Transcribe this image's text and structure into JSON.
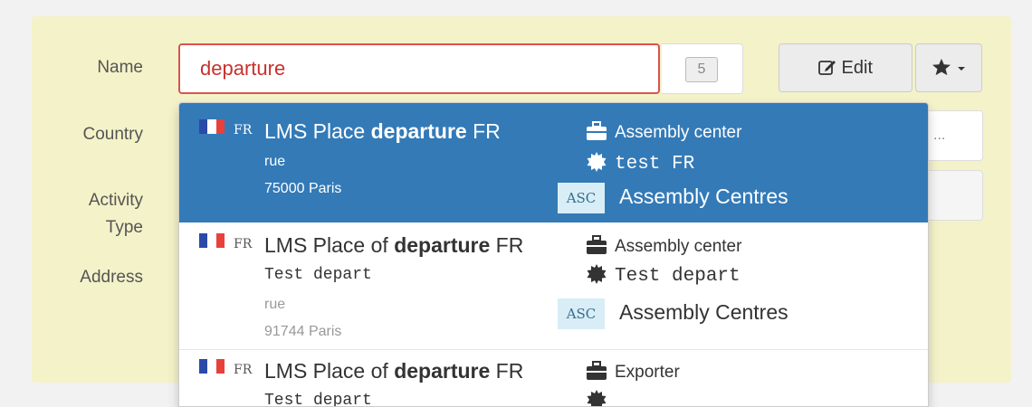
{
  "form": {
    "name_label": "Name",
    "country_label": "Country",
    "activity_label_1": "Activity",
    "activity_label_2": "Type",
    "address_label": "Address",
    "name_value": "departure",
    "count_badge": "5",
    "edit_label": "Edit",
    "country_placeholder": "..."
  },
  "colors": {
    "panel_bg": "#f4f2c8",
    "active_row": "#337ab7",
    "error_border": "#d9534f",
    "asc_badge_bg": "#d9edf7"
  },
  "dropdown": {
    "items": [
      {
        "country_code": "FR",
        "title_prefix": "LMS Place ",
        "title_bold": "departure",
        "title_suffix": " FR",
        "street": "rue",
        "city": "75000 Paris",
        "type": "Assembly center",
        "tag": "test FR",
        "asc_badge": "ASC",
        "category": "Assembly Centres"
      },
      {
        "country_code": "FR",
        "title_prefix": "LMS Place of ",
        "title_bold": "departure",
        "title_suffix": " FR",
        "mono_line": "Test depart",
        "street": "rue",
        "city": "91744 Paris",
        "type": "Assembly center",
        "tag": "Test depart",
        "asc_badge": "ASC",
        "category": "Assembly Centres"
      },
      {
        "country_code": "FR",
        "title_prefix": "LMS Place of ",
        "title_bold": "departure",
        "title_suffix": " FR",
        "mono_line": "Test depart",
        "type": "Exporter"
      }
    ]
  }
}
